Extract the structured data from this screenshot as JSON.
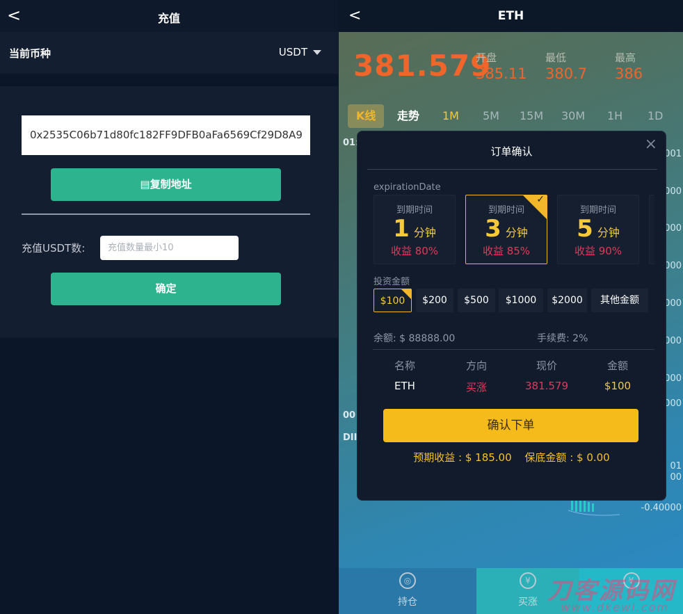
{
  "left": {
    "header": {
      "back": "<",
      "title": "充值"
    },
    "currency": {
      "label": "当前币种",
      "value": "USDT"
    },
    "address": "0x2535C06b71d80fc182FF9DFB0aFa6569Cf29D8A9",
    "copy_button": "复制地址",
    "amount_label": "充值USDT数:",
    "amount_placeholder": "充值数量最小10",
    "confirm_button": "确定"
  },
  "right": {
    "header": {
      "back": "<",
      "title": "ETH"
    },
    "price": "381.579",
    "stats": [
      {
        "label": "开盘",
        "value": "385.11"
      },
      {
        "label": "最低",
        "value": "380.7"
      },
      {
        "label": "最高",
        "value": "386"
      }
    ],
    "tabs": [
      "K线",
      "走势",
      "1M",
      "5M",
      "15M",
      "30M",
      "1H",
      "1D"
    ],
    "side_ticks": [
      "001",
      "000",
      "000",
      "000",
      "000",
      "000",
      "000",
      "000",
      "01",
      "00",
      "-0.40000"
    ],
    "side_left": [
      "01:",
      "00",
      "DII"
    ],
    "bottom_nav": [
      {
        "label": "持仓",
        "icon": "coins-icon"
      },
      {
        "label": "买涨",
        "icon": "yen-icon"
      },
      {
        "label": "",
        "icon": "yen-icon"
      }
    ],
    "watermark": "刀客源码网",
    "watermark_sub": "www.dkewl.com"
  },
  "modal": {
    "title": "订单确认",
    "close": "×",
    "expiration_label": "expirationDate",
    "options": [
      {
        "top": "到期时间",
        "num": "1",
        "unit": "分钟",
        "profit": "收益 80%"
      },
      {
        "top": "到期时间",
        "num": "3",
        "unit": "分钟",
        "profit": "收益 85%"
      },
      {
        "top": "到期时间",
        "num": "5",
        "unit": "分钟",
        "profit": "收益 90%"
      }
    ],
    "selected_option": 1,
    "invest_label": "投资金额",
    "amounts": [
      "$100",
      "$200",
      "$500",
      "$1000",
      "$2000",
      "其他金额"
    ],
    "selected_amount": 0,
    "balance": "余额: $ 88888.00",
    "fee": "手续费:  2%",
    "table": {
      "headers": [
        "名称",
        "方向",
        "现价",
        "金额"
      ],
      "row": [
        "ETH",
        "买涨",
        "381.579",
        "$100"
      ]
    },
    "confirm_button": "确认下单",
    "expected": "预期收益 : $ 185.00",
    "margin": "保底金额 : $ 0.00",
    "colors": {
      "accent": "#f5bb1b",
      "up": "#e2395b",
      "green": "#2db48f"
    }
  }
}
